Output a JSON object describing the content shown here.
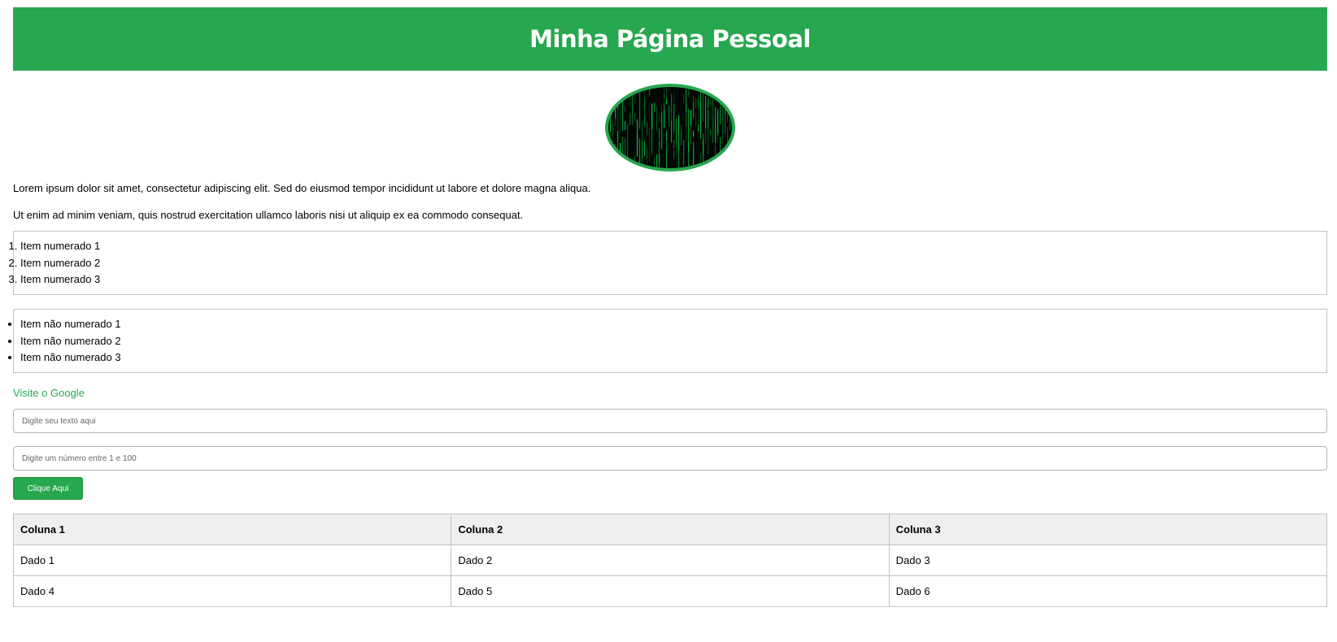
{
  "header": {
    "title": "Minha Página Pessoal"
  },
  "colors": {
    "accent": "#27a74f",
    "header_text": "#ffffff"
  },
  "avatar": {
    "icon": "matrix-code-image"
  },
  "paragraphs": [
    "Lorem ipsum dolor sit amet, consectetur adipiscing elit. Sed do eiusmod tempor incididunt ut labore et dolore magna aliqua.",
    "Ut enim ad minim veniam, quis nostrud exercitation ullamco laboris nisi ut aliquip ex ea commodo consequat."
  ],
  "ordered_list": [
    "Item numerado 1",
    "Item numerado 2",
    "Item numerado 3"
  ],
  "unordered_list": [
    "Item não numerado 1",
    "Item não numerado 2",
    "Item não numerado 3"
  ],
  "link": {
    "label": "Visite o Google"
  },
  "inputs": {
    "text_placeholder": "Digite seu texto aqui",
    "number_placeholder": "Digite um número entre 1 e 100"
  },
  "button": {
    "label": "Clique Aqui"
  },
  "table": {
    "headers": [
      "Coluna 1",
      "Coluna 2",
      "Coluna 3"
    ],
    "rows": [
      [
        "Dado 1",
        "Dado 2",
        "Dado 3"
      ],
      [
        "Dado 4",
        "Dado 5",
        "Dado 6"
      ]
    ]
  }
}
